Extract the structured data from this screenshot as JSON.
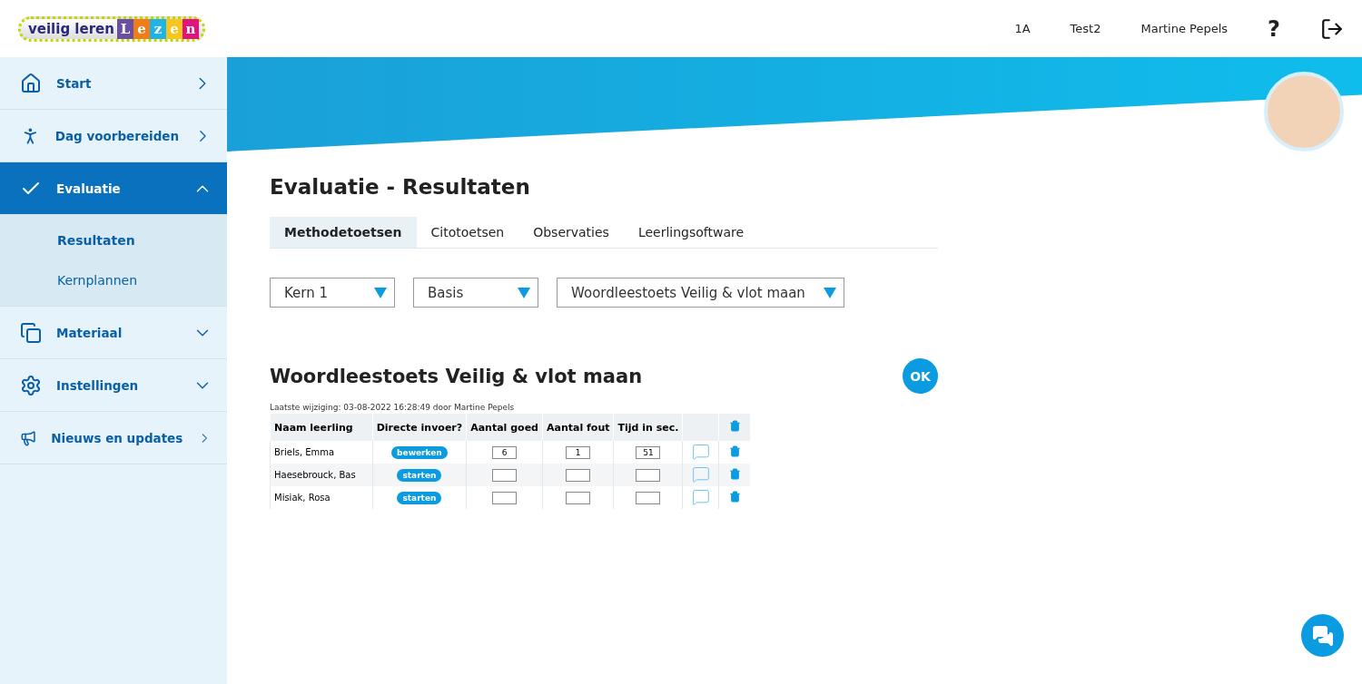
{
  "logo": {
    "text": "veilig leren",
    "letters": [
      {
        "char": "L",
        "color": "#6a4fa3"
      },
      {
        "char": "e",
        "color": "#f07d1a"
      },
      {
        "char": "z",
        "color": "#1fb3e6"
      },
      {
        "char": "e",
        "color": "#f7c51e"
      },
      {
        "char": "n",
        "color": "#e3127d"
      }
    ]
  },
  "header": {
    "items": [
      "1A",
      "Test2",
      "Martine Pepels"
    ],
    "help": "?"
  },
  "sidebar": {
    "items": [
      {
        "kind": "home",
        "label": "Start",
        "selected": false
      },
      {
        "kind": "person",
        "label": "Dag voorbereiden",
        "selected": false
      },
      {
        "kind": "check",
        "label": "Evaluatie",
        "selected": true,
        "expanded": true,
        "children": [
          {
            "label": "Resultaten",
            "selected": true
          },
          {
            "label": "Kernplannen",
            "selected": false
          }
        ]
      },
      {
        "kind": "cards",
        "label": "Materiaal",
        "selected": false,
        "expanded": false
      },
      {
        "kind": "gear",
        "label": "Instellingen",
        "selected": false,
        "expanded": false
      },
      {
        "kind": "megaphone",
        "label": "Nieuws en updates",
        "selected": false
      }
    ]
  },
  "page": {
    "title": "Evaluatie - Resultaten",
    "tabs": [
      {
        "label": "Methodetoetsen",
        "selected": true
      },
      {
        "label": "Citotoetsen",
        "selected": false
      },
      {
        "label": "Observaties",
        "selected": false
      },
      {
        "label": "Leerlingsoftware",
        "selected": false
      }
    ],
    "filters": [
      {
        "value": "Kern 1"
      },
      {
        "value": "Basis"
      },
      {
        "value": "Woordleestoets Veilig & vlot maan"
      }
    ],
    "section_title": "Woordleestoets Veilig & vlot maan",
    "ok_button": "OK",
    "last_change": "Laatste wijziging: 03-08-2022 16:28:49 door Martine Pepels",
    "table": {
      "columns": [
        "Naam leerling",
        "Directe invoer?",
        "Aantal goed",
        "Aantal fout",
        "Tijd in sec."
      ],
      "rows": [
        {
          "name": "Briels, Emma",
          "action": "bewerken",
          "goed": "6",
          "fout": "1",
          "tijd": "51"
        },
        {
          "name": "Haesebrouck, Bas",
          "action": "starten",
          "goed": "",
          "fout": "",
          "tijd": ""
        },
        {
          "name": "Misiak, Rosa",
          "action": "starten",
          "goed": "",
          "fout": "",
          "tijd": ""
        }
      ]
    }
  }
}
